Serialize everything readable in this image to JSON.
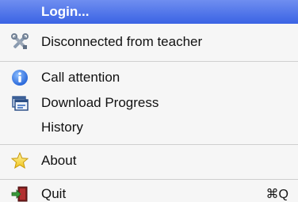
{
  "menu": {
    "items": [
      {
        "label": "Login...",
        "icon": "none",
        "highlighted": true
      },
      {
        "label": "Disconnected from teacher",
        "icon": "tools-icon"
      },
      {
        "label": "Call attention",
        "icon": "info-icon"
      },
      {
        "label": "Download Progress",
        "icon": "download-window-icon"
      },
      {
        "label": "History",
        "icon": "none"
      },
      {
        "label": "About",
        "icon": "star-icon"
      },
      {
        "label": "Quit",
        "icon": "exit-door-icon",
        "shortcut": "⌘Q"
      }
    ]
  },
  "colors": {
    "highlight_top": "#6f8ef0",
    "highlight_bottom": "#3a63e4",
    "menu_background": "#f6f6f6",
    "separator": "#cfcfcf"
  }
}
